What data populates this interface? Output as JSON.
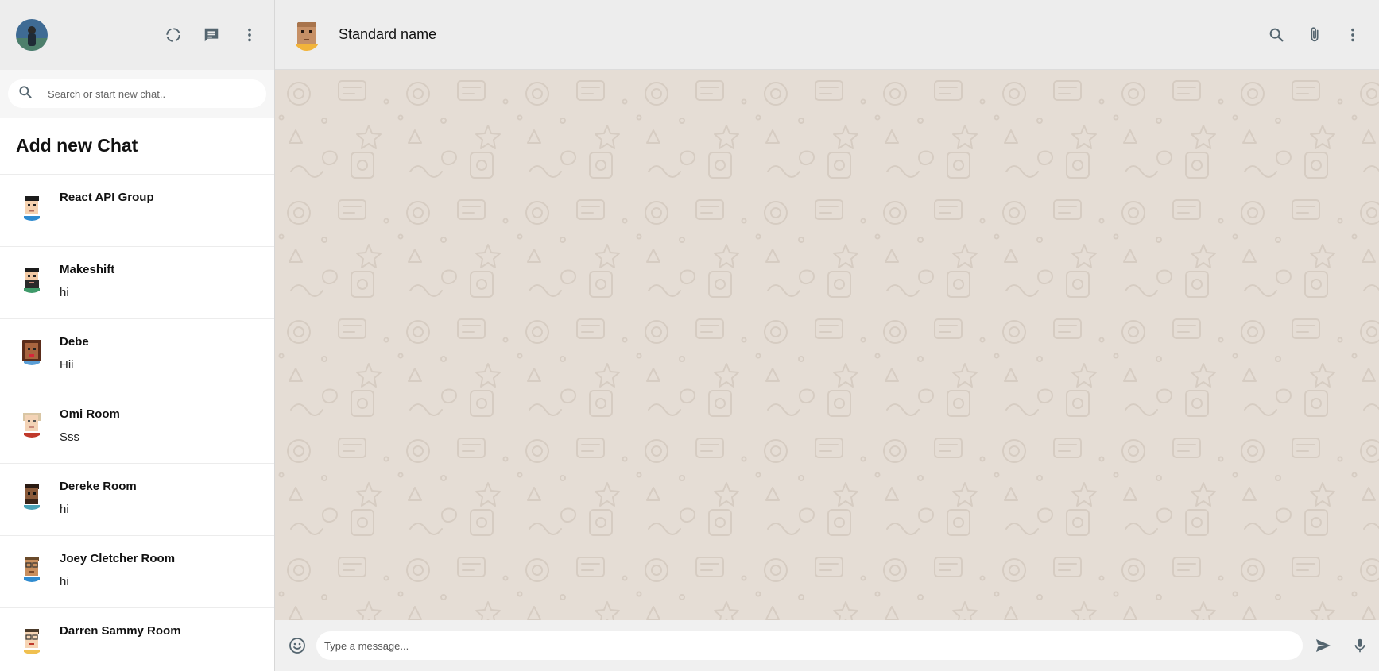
{
  "sidebar": {
    "search_placeholder": "Search or start new chat..",
    "add_chat_label": "Add new Chat",
    "chats": [
      {
        "name": "React API Group",
        "last_message": ""
      },
      {
        "name": "Makeshift",
        "last_message": "hi"
      },
      {
        "name": "Debe",
        "last_message": "Hii"
      },
      {
        "name": "Omi Room",
        "last_message": "Sss"
      },
      {
        "name": "Dereke Room",
        "last_message": "hi"
      },
      {
        "name": "Joey Cletcher Room",
        "last_message": "hi"
      },
      {
        "name": "Darren Sammy Room",
        "last_message": ""
      }
    ]
  },
  "header": {
    "contact_name": "Standard name"
  },
  "footer": {
    "message_placeholder": "Type a message..."
  },
  "icons": {
    "status": "status-icon",
    "new_chat": "chat-icon",
    "menu": "more-vert-icon",
    "search": "search-icon",
    "attach": "attach-icon",
    "emoji": "emoji-icon",
    "send": "send-icon",
    "mic": "mic-icon"
  },
  "colors": {
    "header_bg": "#ededed",
    "chat_bg": "#e5ddd5",
    "icon": "#54656f"
  }
}
